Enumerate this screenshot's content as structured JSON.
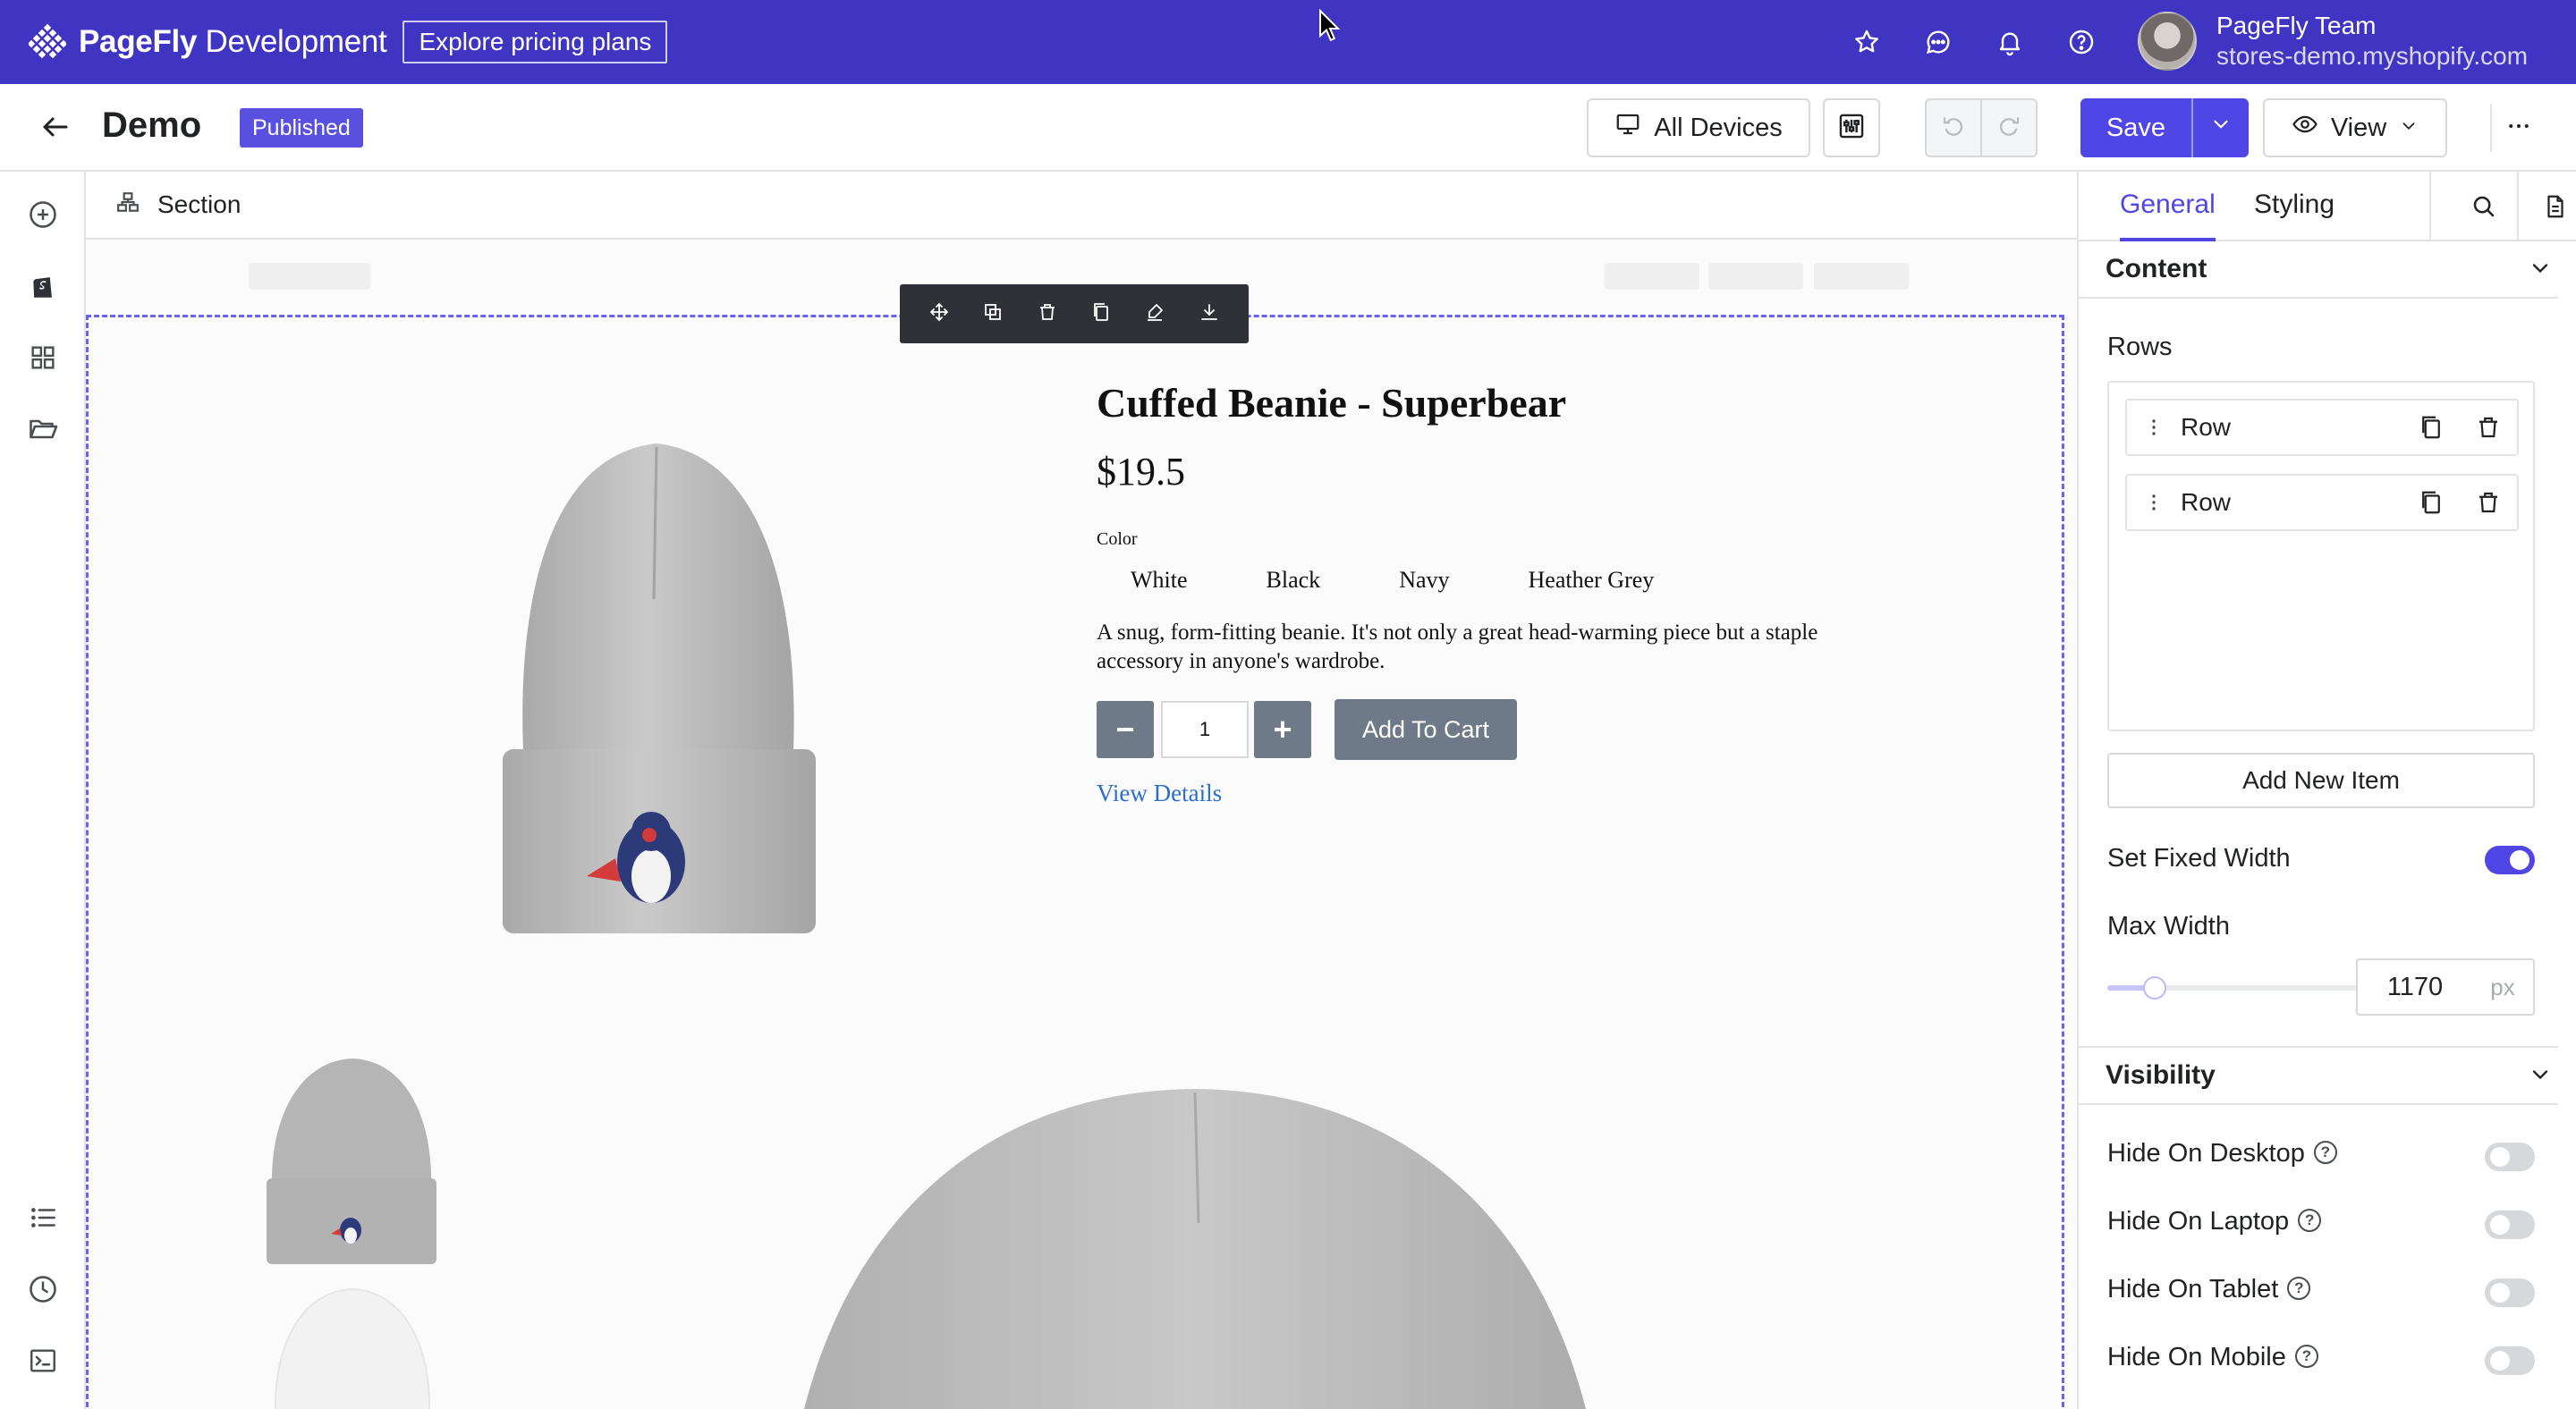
{
  "topbar": {
    "brand_bold": "PageFly",
    "brand_rest": " Development",
    "explore_label": "Explore pricing plans",
    "icons": [
      "star-icon",
      "chat-icon",
      "bell-icon",
      "help-icon"
    ],
    "user_name": "PageFly Team",
    "store": "stores-demo.myshopify.com",
    "color": "#4035c2"
  },
  "header": {
    "page_name": "Demo",
    "status": "Published",
    "device_label": "All Devices",
    "save_label": "Save",
    "view_label": "View"
  },
  "left_rail": {
    "icons": [
      "add-icon",
      "shopify-icon",
      "grid-icon",
      "folder-icon",
      "list-icon",
      "history-icon",
      "console-icon"
    ]
  },
  "breadcrumb": {
    "label": "Section"
  },
  "product": {
    "title": "Cuffed Beanie - Superbear",
    "price": "$19.5",
    "color_label": "Color",
    "colors": [
      "White",
      "Black",
      "Navy",
      "Heather Grey"
    ],
    "description": "A snug, form-fitting beanie. It's not only a great head-warming piece but a staple accessory in anyone's wardrobe.",
    "minus": "−",
    "quantity": "1",
    "plus": "+",
    "add_to_cart": "Add To Cart",
    "view_details": "View Details"
  },
  "panel": {
    "tabs": [
      "General",
      "Styling"
    ],
    "content_heading": "Content",
    "rows_label": "Rows",
    "rows": [
      {
        "label": "Row"
      },
      {
        "label": "Row"
      }
    ],
    "add_item_label": "Add New Item",
    "fixed_width_label": "Set Fixed Width",
    "fixed_width_on": true,
    "max_width_label": "Max Width",
    "max_width_value": "1170",
    "max_width_unit": "px",
    "slider_fraction": 0.19,
    "visibility_heading": "Visibility",
    "visibility": [
      {
        "label": "Hide On Desktop",
        "on": false
      },
      {
        "label": "Hide On Laptop",
        "on": false
      },
      {
        "label": "Hide On Tablet",
        "on": false
      },
      {
        "label": "Hide On Mobile",
        "on": false
      }
    ],
    "help_glyph": "?",
    "accent": "#4f46e5"
  }
}
